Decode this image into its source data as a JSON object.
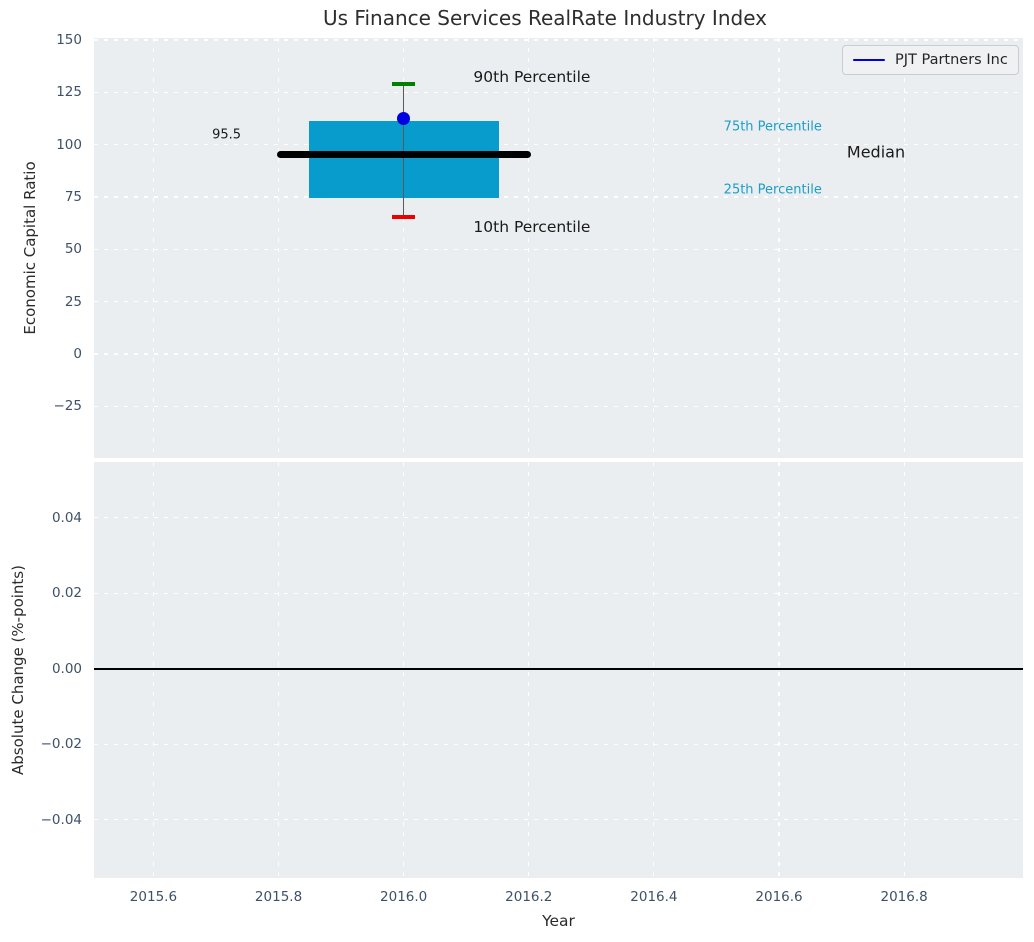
{
  "title": "Us Finance Services RealRate Industry Index",
  "legend": {
    "label": "PJT Partners Inc"
  },
  "colors": {
    "plot_bg": "#eaeef0",
    "grid": "#ffffff",
    "tick": "#3e5168",
    "axis_label": "#2b2b2b",
    "title": "#2e2e2e",
    "box_fill": "#089ccd",
    "median": "#000000",
    "whisker": "#5a5a5a",
    "p90_cap": "#008000",
    "p10_cap": "#ef0000",
    "company": "#0000e0",
    "annotation_dark": "#1a1a1a",
    "annotation_cyan": "#1b9ec9",
    "legend_bg": "#f0f1f3",
    "legend_border": "#c9ccd2",
    "legend_text": "#262626",
    "zero_line": "#000000"
  },
  "chart_data": [
    {
      "type": "boxplot",
      "ylabel": "Economic Capital Ratio",
      "xlabel": "",
      "xlim": [
        2015.505,
        2016.99
      ],
      "ylim": [
        -49.7,
        150.95
      ],
      "grid": true,
      "yticks": [
        {
          "value": 150,
          "label": "150"
        },
        {
          "value": 125,
          "label": "125"
        },
        {
          "value": 100,
          "label": "100"
        },
        {
          "value": 75,
          "label": "75"
        },
        {
          "value": 50,
          "label": "50"
        },
        {
          "value": 25,
          "label": "25"
        },
        {
          "value": 0,
          "label": "0"
        },
        {
          "value": -25,
          "label": "−25"
        }
      ],
      "xticks": [
        {
          "value": 2015.6,
          "label": "2015.6"
        },
        {
          "value": 2015.8,
          "label": "2015.8"
        },
        {
          "value": 2016.0,
          "label": "2016.0"
        },
        {
          "value": 2016.2,
          "label": "2016.2"
        },
        {
          "value": 2016.4,
          "label": "2016.4"
        },
        {
          "value": 2016.6,
          "label": "2016.6"
        },
        {
          "value": 2016.8,
          "label": "2016.8"
        }
      ],
      "box": {
        "x": 2016.0,
        "median": 95.5,
        "q1": 74.4,
        "q3": 111.5,
        "p10": 65.4,
        "p90": 129.0,
        "box_halfwidth": 0.152,
        "median_halfwidth": 0.203,
        "cap_halfwidth": 0.018
      },
      "company_point": {
        "x": 2016.0,
        "y": 112.6,
        "label": "PJT Partners Inc"
      },
      "annotations": [
        {
          "text": "90th Percentile",
          "x": 2016.205,
          "y": 132.4,
          "size": 15.5,
          "color": "#1a1a1a"
        },
        {
          "text": "10th Percentile",
          "x": 2016.205,
          "y": 60.6,
          "size": 15.5,
          "color": "#1a1a1a"
        },
        {
          "text": "95.5",
          "x": 2015.717,
          "y": 104.4,
          "size": 13,
          "color": "#1a1a1a"
        },
        {
          "text": "75th Percentile",
          "x": 2016.59,
          "y": 108.2,
          "size": 13,
          "color": "#1b9ec9"
        },
        {
          "text": "25th Percentile",
          "x": 2016.59,
          "y": 78.2,
          "size": 13,
          "color": "#1b9ec9"
        },
        {
          "text": "Median",
          "x": 2016.755,
          "y": 96.3,
          "size": 16,
          "color": "#1a1a1a"
        }
      ]
    },
    {
      "type": "line",
      "ylabel": "Absolute Change (%-points)",
      "xlabel": "Year",
      "xlim": [
        2015.505,
        2016.99
      ],
      "ylim": [
        -0.0554,
        0.0548
      ],
      "grid": true,
      "zero_line": 0.0,
      "series": [],
      "yticks": [
        {
          "value": 0.04,
          "label": "0.04"
        },
        {
          "value": 0.02,
          "label": "0.02"
        },
        {
          "value": 0.0,
          "label": "0.00"
        },
        {
          "value": -0.02,
          "label": "−0.02"
        },
        {
          "value": -0.04,
          "label": "−0.04"
        }
      ],
      "xticks": [
        {
          "value": 2015.6,
          "label": "2015.6"
        },
        {
          "value": 2015.8,
          "label": "2015.8"
        },
        {
          "value": 2016.0,
          "label": "2016.0"
        },
        {
          "value": 2016.2,
          "label": "2016.2"
        },
        {
          "value": 2016.4,
          "label": "2016.4"
        },
        {
          "value": 2016.6,
          "label": "2016.6"
        },
        {
          "value": 2016.8,
          "label": "2016.8"
        }
      ]
    }
  ]
}
